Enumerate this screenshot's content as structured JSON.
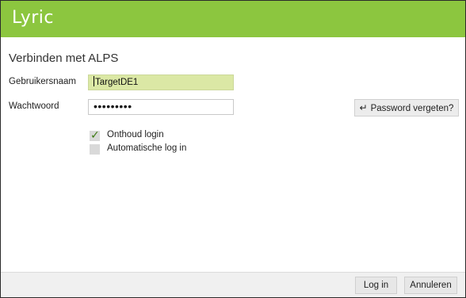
{
  "app": {
    "logo_text": "Lyric"
  },
  "dialog": {
    "heading": "Verbinden met ALPS"
  },
  "form": {
    "username_label": "Gebruikersnaam",
    "username_value": "TargetDE1",
    "password_label": "Wachtwoord",
    "password_value": "•••••••••",
    "forgot_password_label": "Password vergeten?",
    "remember_login": {
      "label": "Onthoud login",
      "checked": true
    },
    "auto_login": {
      "label": "Automatische log in",
      "checked": false
    }
  },
  "footer": {
    "login_label": "Log in",
    "cancel_label": "Annuleren"
  },
  "colors": {
    "brand_green": "#8cc63f",
    "field_highlight": "#dbe8a5",
    "check_green": "#3d7a12"
  },
  "icons": {
    "forgot_password": "enter-arrow-icon",
    "remember_check": "checkmark-icon"
  }
}
